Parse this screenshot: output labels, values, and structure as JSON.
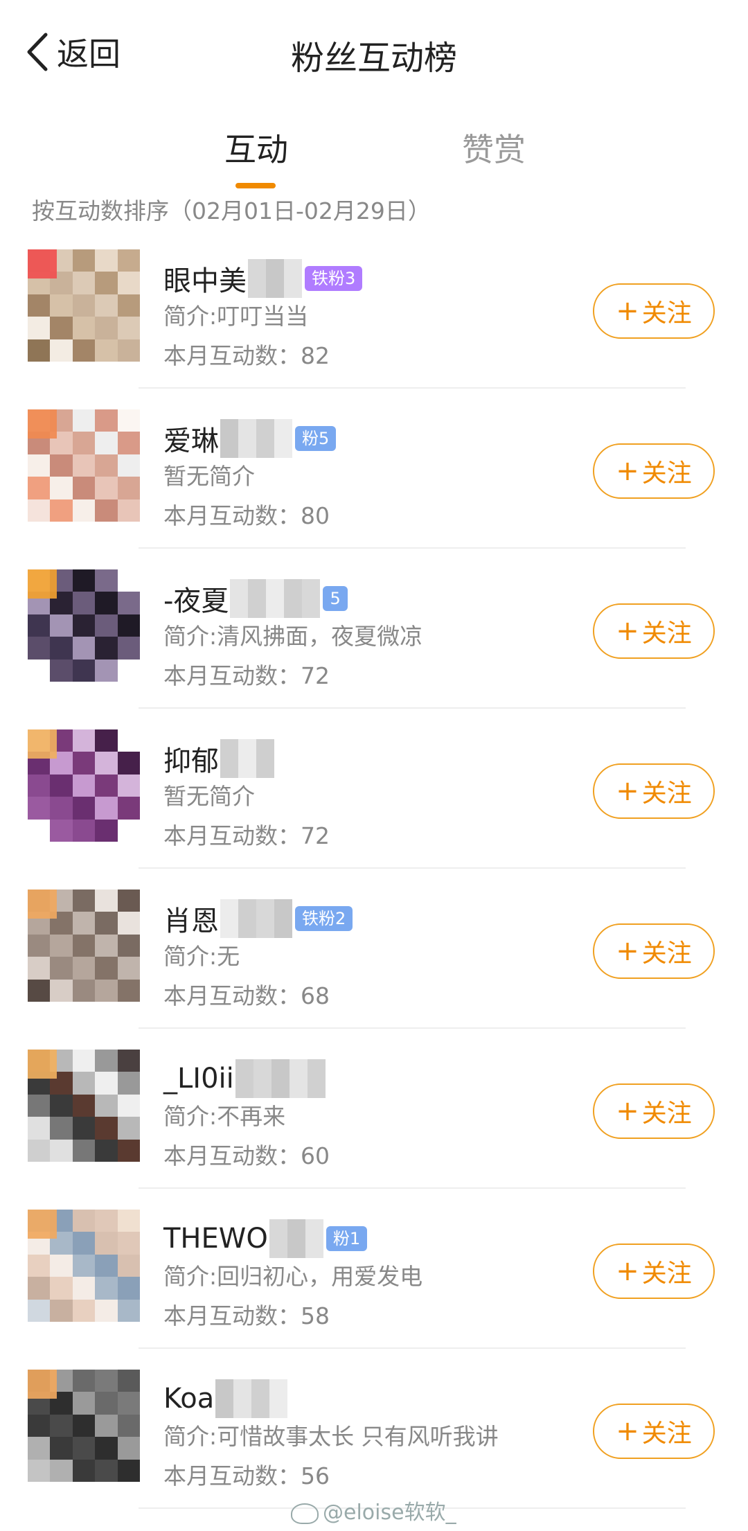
{
  "header": {
    "back_label": "返回",
    "title": "粉丝互动榜"
  },
  "tabs": [
    {
      "label": "互动",
      "active": true
    },
    {
      "label": "赞赏",
      "active": false
    }
  ],
  "sort_label": "按互动数排序（02月01日-02月29日）",
  "colors": {
    "accent": "#f08a00",
    "badge_purple": "#b07cff",
    "badge_blue": "#79a8f0"
  },
  "follow_label": "关注",
  "fans": [
    {
      "name": "眼中美",
      "badge": "铁粉3",
      "intro": "简介:叮叮当当",
      "count": "本月互动数：82"
    },
    {
      "name": "爱琳",
      "badge": "粉5",
      "intro": "暂无简介",
      "count": "本月互动数：80"
    },
    {
      "name": "-夜夏",
      "badge": "5",
      "intro": "简介:清风拂面，夜夏微凉",
      "count": "本月互动数：72"
    },
    {
      "name": "抑郁",
      "badge": "",
      "intro": "暂无简介",
      "count": "本月互动数：72"
    },
    {
      "name": "肖恩",
      "badge": "铁粉2",
      "intro": "简介:无",
      "count": "本月互动数：68"
    },
    {
      "name": "_LI0ii",
      "badge": "",
      "intro": "简介:不再来",
      "count": "本月互动数：60"
    },
    {
      "name": "THEWO",
      "badge": "粉1",
      "intro": "简介:回归初心，用爱发电",
      "count": "本月互动数：58"
    },
    {
      "name": "Koa",
      "badge": "",
      "intro": "简介:可惜故事太长 只有风听我讲",
      "count": "本月互动数：56"
    }
  ],
  "watermark": "@eloise软软_"
}
